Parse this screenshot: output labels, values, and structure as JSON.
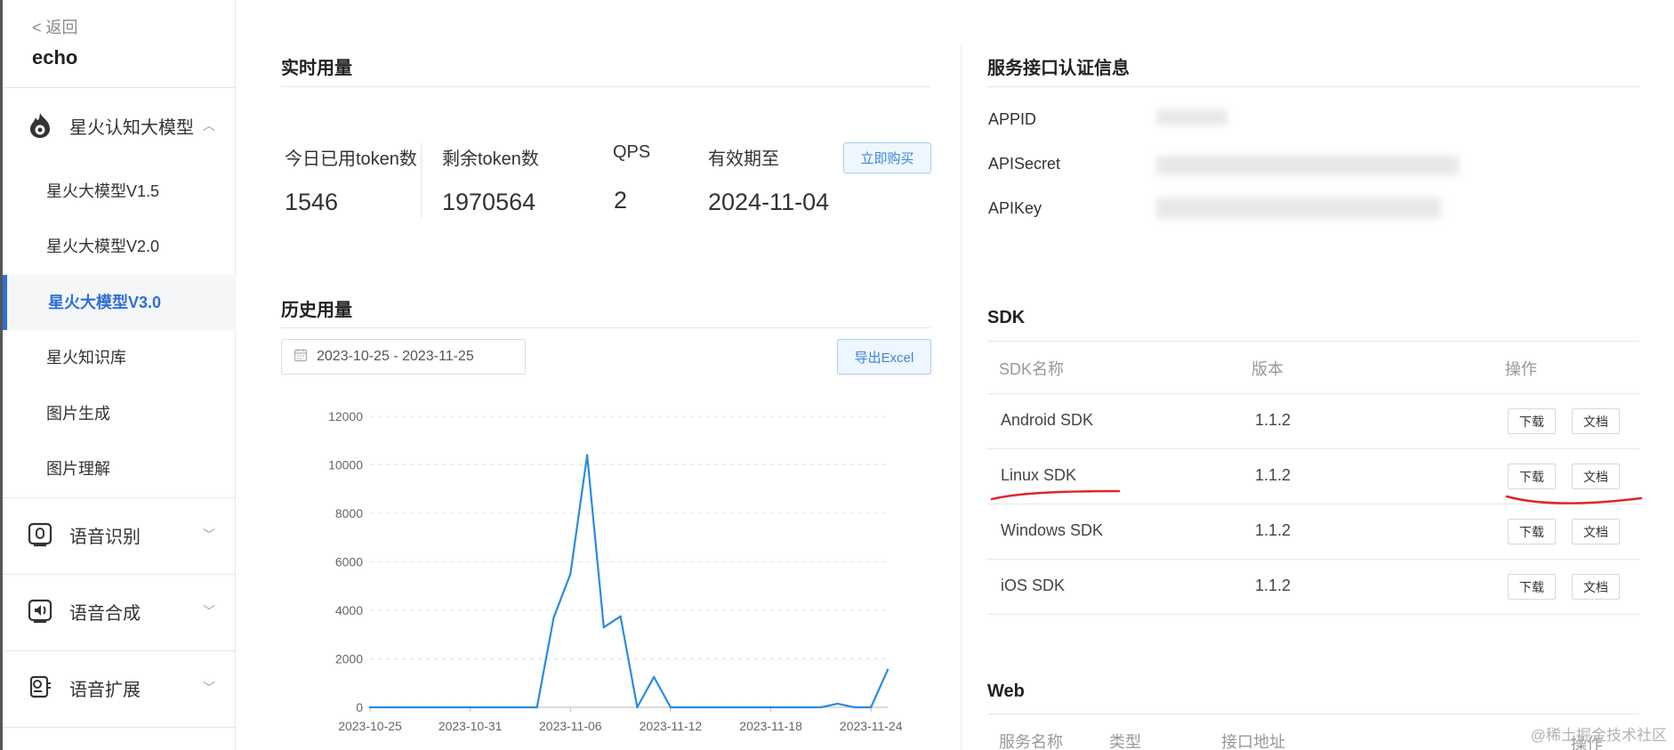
{
  "sidebar": {
    "back_label": "< 返回",
    "app_name": "echo",
    "groups": [
      {
        "label": "星火认知大模型",
        "icon": "flame-icon",
        "expanded": true
      },
      {
        "label": "语音识别",
        "icon": "voice-recognition-icon",
        "expanded": false
      },
      {
        "label": "语音合成",
        "icon": "speech-synthesis-icon",
        "expanded": false
      },
      {
        "label": "语音扩展",
        "icon": "voice-extension-icon",
        "expanded": false
      }
    ],
    "items": [
      {
        "label": "星火大模型V1.5",
        "active": false
      },
      {
        "label": "星火大模型V2.0",
        "active": false
      },
      {
        "label": "星火大模型V3.0",
        "active": true
      },
      {
        "label": "星火知识库",
        "active": false
      },
      {
        "label": "图片生成",
        "active": false
      },
      {
        "label": "图片理解",
        "active": false
      }
    ]
  },
  "realtime": {
    "title": "实时用量",
    "used_today_label": "今日已用token数",
    "used_today": "1546",
    "remaining_label": "剩余token数",
    "remaining": "1970564",
    "qps_label": "QPS",
    "qps": "2",
    "expiry_label": "有效期至",
    "expiry": "2024-11-04",
    "buy_button": "立即购买"
  },
  "history": {
    "title": "历史用量",
    "date_start": "2023-10-25",
    "date_sep": " - ",
    "date_end": "2023-11-25",
    "export_button": "导出Excel"
  },
  "chart_data": {
    "type": "line",
    "title": "",
    "xlabel": "",
    "ylabel": "",
    "ylim": [
      0,
      12000
    ],
    "yticks": [
      0,
      2000,
      4000,
      6000,
      8000,
      10000,
      12000
    ],
    "xtick_labels": [
      "2023-10-25",
      "2023-10-31",
      "2023-11-06",
      "2023-11-12",
      "2023-11-18",
      "2023-11-24"
    ],
    "x": [
      "2023-10-25",
      "2023-10-26",
      "2023-10-27",
      "2023-10-28",
      "2023-10-29",
      "2023-10-30",
      "2023-10-31",
      "2023-11-01",
      "2023-11-02",
      "2023-11-03",
      "2023-11-04",
      "2023-11-05",
      "2023-11-06",
      "2023-11-07",
      "2023-11-08",
      "2023-11-09",
      "2023-11-10",
      "2023-11-11",
      "2023-11-12",
      "2023-11-13",
      "2023-11-14",
      "2023-11-15",
      "2023-11-16",
      "2023-11-17",
      "2023-11-18",
      "2023-11-19",
      "2023-11-20",
      "2023-11-21",
      "2023-11-22",
      "2023-11-23",
      "2023-11-24",
      "2023-11-25"
    ],
    "series": [
      {
        "values": [
          0,
          0,
          0,
          0,
          0,
          0,
          0,
          0,
          0,
          0,
          0,
          3700,
          5500,
          10400,
          3300,
          3750,
          0,
          1250,
          0,
          0,
          0,
          0,
          0,
          0,
          0,
          0,
          0,
          0,
          150,
          0,
          0,
          1546
        ]
      }
    ],
    "color": "#2a8be0",
    "grid": true
  },
  "auth": {
    "title": "服务接口认证信息",
    "appid_label": "APPID",
    "apisecret_label": "APISecret",
    "apikey_label": "APIKey"
  },
  "sdk": {
    "title": "SDK",
    "headers": {
      "name": "SDK名称",
      "version": "版本",
      "action": "操作"
    },
    "download_label": "下载",
    "docs_label": "文档",
    "rows": [
      {
        "name": "Android SDK",
        "version": "1.1.2"
      },
      {
        "name": "Linux SDK",
        "version": "1.1.2"
      },
      {
        "name": "Windows SDK",
        "version": "1.1.2"
      },
      {
        "name": "iOS SDK",
        "version": "1.1.2"
      }
    ]
  },
  "web": {
    "title": "Web",
    "headers": {
      "name": "服务名称",
      "type": "类型",
      "address": "接口地址",
      "action": "操作"
    }
  },
  "watermark": "@稀土掘金技术社区",
  "colors": {
    "accent": "#2f6fd6",
    "chart_line": "#2a8be0",
    "annotation": "#e0262a"
  }
}
